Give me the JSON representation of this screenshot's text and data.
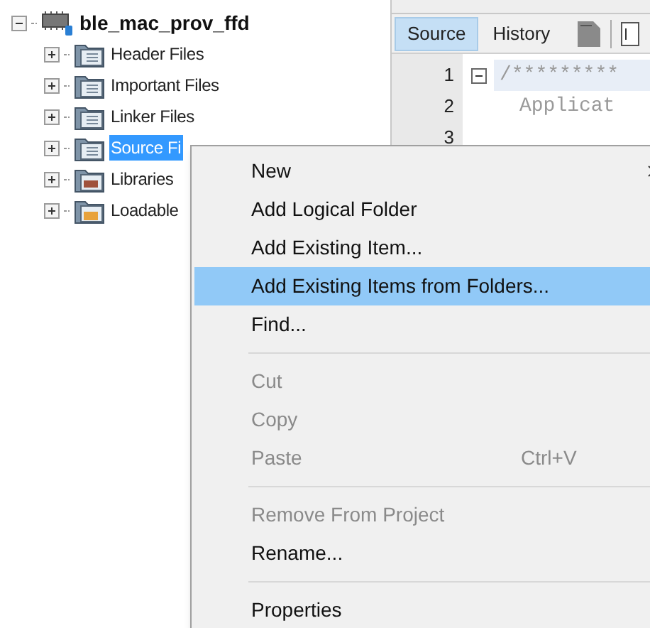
{
  "project_tree": {
    "root": {
      "label": "ble_mac_prov_ffd",
      "expanded": true,
      "children": [
        {
          "label": "Header Files",
          "kind": "folder",
          "expanded": false,
          "selected": false
        },
        {
          "label": "Important Files",
          "kind": "folder",
          "expanded": false,
          "selected": false
        },
        {
          "label": "Linker Files",
          "kind": "folder",
          "expanded": false,
          "selected": false
        },
        {
          "label": "Source Fi",
          "kind": "folder",
          "expanded": false,
          "selected": true
        },
        {
          "label": "Libraries",
          "kind": "library",
          "expanded": false,
          "selected": false
        },
        {
          "label": "Loadable",
          "kind": "loadable",
          "expanded": false,
          "selected": false
        }
      ]
    }
  },
  "editor": {
    "tabs": [
      {
        "label": "Source",
        "selected": true
      },
      {
        "label": "History",
        "selected": false
      }
    ],
    "lines": [
      {
        "number": "1",
        "text": "/*********",
        "foldable": true
      },
      {
        "number": "2",
        "text": "Applicat",
        "foldable": false
      },
      {
        "number": "3",
        "foldable": false
      }
    ]
  },
  "context_menu": {
    "items": [
      {
        "kind": "item",
        "label": "New",
        "submenu": true,
        "disabled": false,
        "selected": false
      },
      {
        "kind": "item",
        "label": "Add Logical Folder",
        "disabled": false,
        "selected": false
      },
      {
        "kind": "item",
        "label": "Add Existing Item...",
        "disabled": false,
        "selected": false
      },
      {
        "kind": "item",
        "label": "Add Existing Items from Folders...",
        "disabled": false,
        "selected": true
      },
      {
        "kind": "item",
        "label": "Find...",
        "disabled": false,
        "selected": false
      },
      {
        "kind": "separator"
      },
      {
        "kind": "item",
        "label": "Cut",
        "disabled": true,
        "selected": false
      },
      {
        "kind": "item",
        "label": "Copy",
        "disabled": true,
        "selected": false
      },
      {
        "kind": "item",
        "label": "Paste",
        "shortcut": "Ctrl+V",
        "disabled": true,
        "selected": false
      },
      {
        "kind": "separator"
      },
      {
        "kind": "item",
        "label": "Remove From Project",
        "disabled": true,
        "selected": false
      },
      {
        "kind": "item",
        "label": "Rename...",
        "disabled": false,
        "selected": false
      },
      {
        "kind": "separator"
      },
      {
        "kind": "item",
        "label": "Properties",
        "disabled": false,
        "selected": false
      }
    ]
  }
}
